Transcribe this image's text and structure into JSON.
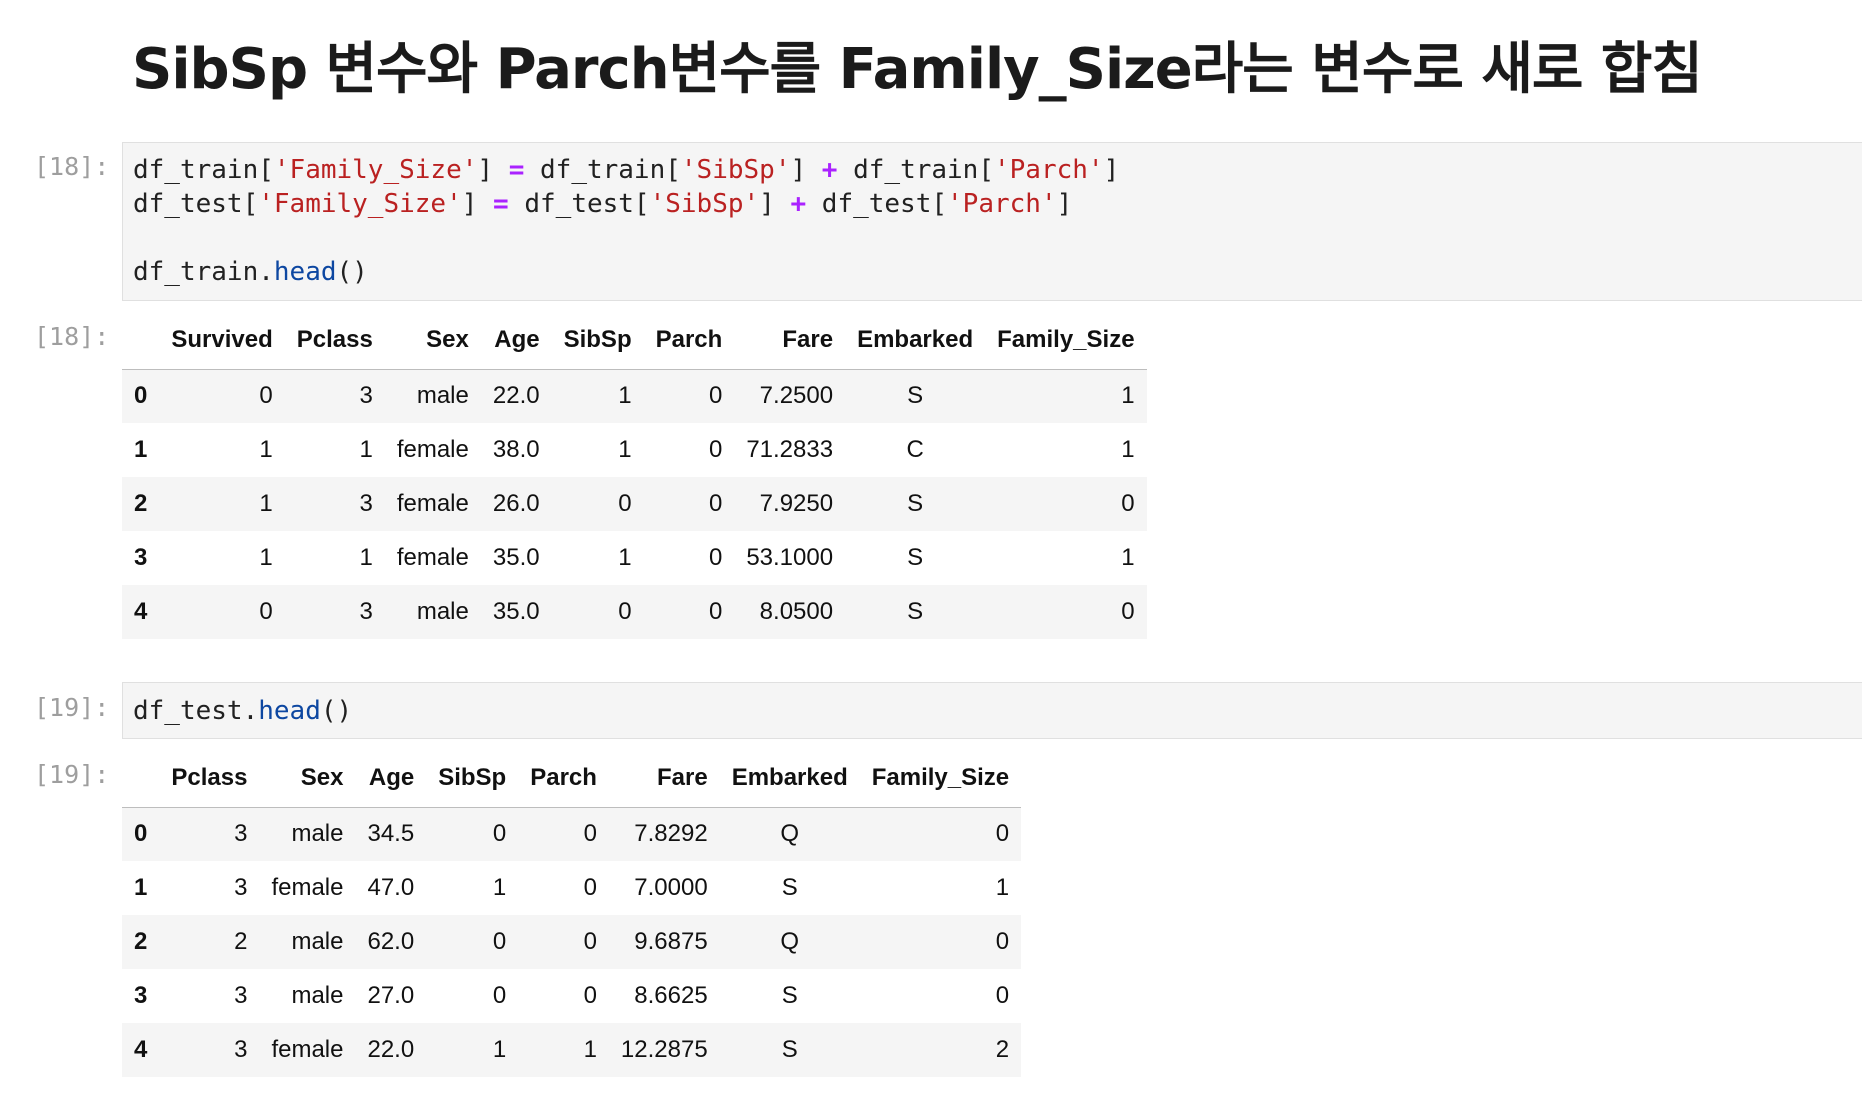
{
  "heading": "SibSp 변수와 Parch변수를 Family_Size라는 변수로 새로 합침",
  "cells": [
    {
      "prompt_in": "[18]:",
      "prompt_out": "[18]:",
      "code": {
        "line1": {
          "v1": "df_train[",
          "s1": "'Family_Size'",
          "v2": "] ",
          "op1": "=",
          "v3": " df_train[",
          "s2": "'SibSp'",
          "v4": "] ",
          "op2": "+",
          "v5": " df_train[",
          "s3": "'Parch'",
          "v6": "]"
        },
        "line2": {
          "v1": "df_test[",
          "s1": "'Family_Size'",
          "v2": "] ",
          "op1": "=",
          "v3": " df_test[",
          "s2": "'SibSp'",
          "v4": "] ",
          "op2": "+",
          "v5": " df_test[",
          "s3": "'Parch'",
          "v6": "]"
        },
        "line4": {
          "v1": "df_train.",
          "fn": "head",
          "v2": "()"
        }
      },
      "table": {
        "columns": [
          "",
          "Survived",
          "Pclass",
          "Sex",
          "Age",
          "SibSp",
          "Parch",
          "Fare",
          "Embarked",
          "Family_Size"
        ],
        "rows": [
          [
            "0",
            "0",
            "3",
            "male",
            "22.0",
            "1",
            "0",
            "7.2500",
            "S",
            "1"
          ],
          [
            "1",
            "1",
            "1",
            "female",
            "38.0",
            "1",
            "0",
            "71.2833",
            "C",
            "1"
          ],
          [
            "2",
            "1",
            "3",
            "female",
            "26.0",
            "0",
            "0",
            "7.9250",
            "S",
            "0"
          ],
          [
            "3",
            "1",
            "1",
            "female",
            "35.0",
            "1",
            "0",
            "53.1000",
            "S",
            "1"
          ],
          [
            "4",
            "0",
            "3",
            "male",
            "35.0",
            "0",
            "0",
            "8.0500",
            "S",
            "0"
          ]
        ]
      }
    },
    {
      "prompt_in": "[19]:",
      "prompt_out": "[19]:",
      "code": {
        "line1": {
          "v1": "df_test.",
          "fn": "head",
          "v2": "()"
        }
      },
      "table": {
        "columns": [
          "",
          "Pclass",
          "Sex",
          "Age",
          "SibSp",
          "Parch",
          "Fare",
          "Embarked",
          "Family_Size"
        ],
        "rows": [
          [
            "0",
            "3",
            "male",
            "34.5",
            "0",
            "0",
            "7.8292",
            "Q",
            "0"
          ],
          [
            "1",
            "3",
            "female",
            "47.0",
            "1",
            "0",
            "7.0000",
            "S",
            "1"
          ],
          [
            "2",
            "2",
            "male",
            "62.0",
            "0",
            "0",
            "9.6875",
            "Q",
            "0"
          ],
          [
            "3",
            "3",
            "male",
            "27.0",
            "0",
            "0",
            "8.6625",
            "S",
            "0"
          ],
          [
            "4",
            "3",
            "female",
            "22.0",
            "1",
            "1",
            "12.2875",
            "S",
            "2"
          ]
        ]
      }
    }
  ]
}
